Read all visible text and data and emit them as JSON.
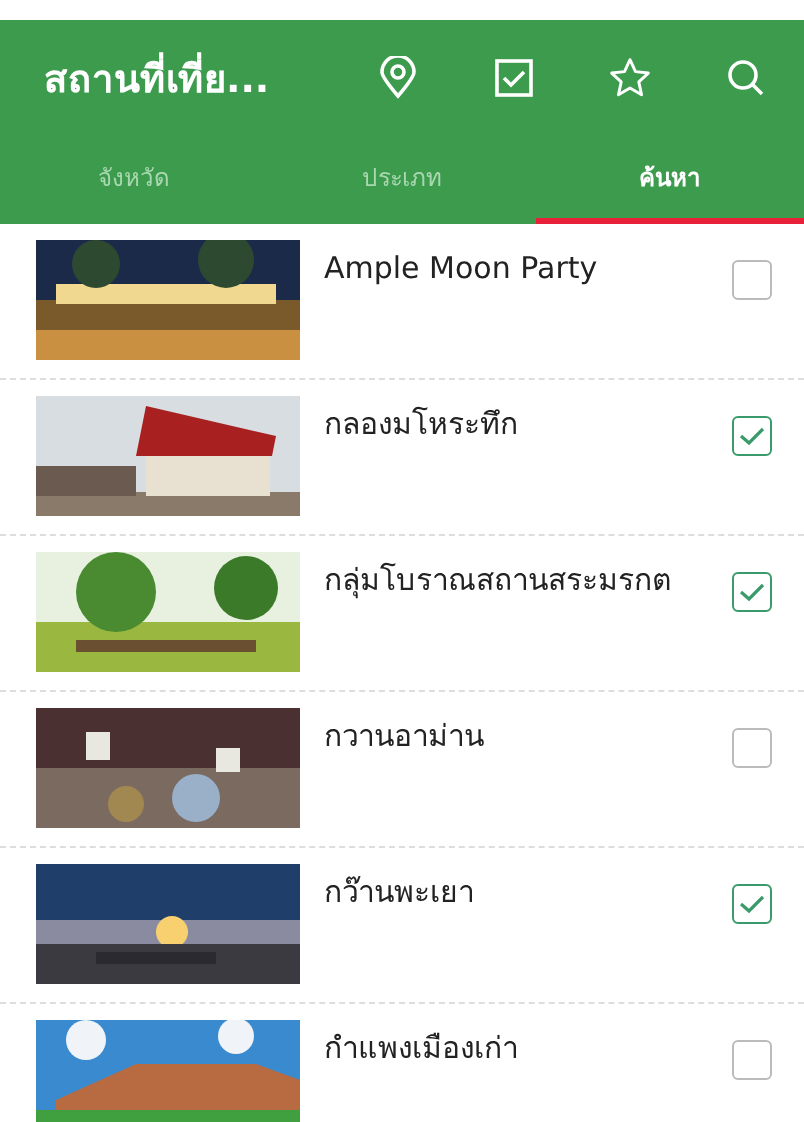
{
  "app_bar": {
    "title": "สถานที่เที่ย..."
  },
  "tabs": [
    {
      "label": "จังหวัด",
      "selected": false
    },
    {
      "label": "ประเภท",
      "selected": false
    },
    {
      "label": "ค้นหา",
      "selected": true
    }
  ],
  "places": [
    {
      "name": "Ample Moon Party",
      "checked": false
    },
    {
      "name": "กลองมโหระทึก",
      "checked": true
    },
    {
      "name": "กลุ่มโบราณสถานสระมรกต",
      "checked": true
    },
    {
      "name": "กวานอาม่าน",
      "checked": false
    },
    {
      "name": "กว๊านพะเยา",
      "checked": true
    },
    {
      "name": "กำแพงเมืองเก่า",
      "checked": false
    }
  ]
}
